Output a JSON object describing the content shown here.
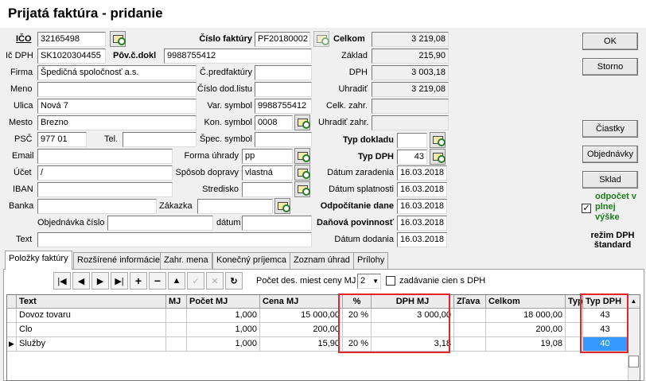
{
  "window": {
    "title": "Prijatá faktúra  -  pridanie"
  },
  "left": {
    "ico_label": "IČO",
    "ico_value": "32165498",
    "icdph_label": "Ič DPH",
    "icdph_value": "SK1020304455",
    "pov_label": "Pôv.č.dokl",
    "pov_value": "9988755412",
    "firma_label": "Firma",
    "firma_value": "Špedičná spoločnosť a.s.",
    "meno_label": "Meno",
    "meno_value": "",
    "ulica_label": "Ulica",
    "ulica_value": "Nová 7",
    "mesto_label": "Mesto",
    "mesto_value": "Brezno",
    "psc_label": "PSČ",
    "psc_value": "977 01",
    "tel_label": "Tel.",
    "tel_value": "",
    "email_label": "Email",
    "email_value": "",
    "ucet_label": "Účet",
    "ucet_value": "/",
    "iban_label": "IBAN",
    "iban_value": "",
    "banka_label": "Banka",
    "banka_value": "",
    "objednavka_label": "Objednávka číslo",
    "objednavka_value": "",
    "text_label": "Text",
    "text_value": ""
  },
  "middle": {
    "cislo_faktury_label": "Číslo faktúry",
    "cislo_faktury_value": "PF20180002",
    "cpredfaktury_label": "Č.predfaktúry",
    "cpredfaktury_value": "",
    "cdodlistu_label": "Číslo dod.listu",
    "cdodlistu_value": "",
    "var_symbol_label": "Var. symbol",
    "var_symbol_value": "9988755412",
    "kon_symbol_label": "Kon. symbol",
    "kon_symbol_value": "0008",
    "spec_symbol_label": "Špec. symbol",
    "spec_symbol_value": "",
    "forma_uhrady_label": "Forma úhrady",
    "forma_uhrady_value": "pp",
    "sposob_dopravy_label": "Spôsob dopravy",
    "sposob_dopravy_value": "vlastná",
    "stredisko_label": "Stredisko",
    "stredisko_value": "",
    "zakazka_label": "Zákazka",
    "zakazka_value": "",
    "datum_label": "dátum",
    "datum_value": ""
  },
  "totals": {
    "celkom_label": "Celkom",
    "celkom_value": "3 219,08",
    "zaklad_label": "Základ",
    "zaklad_value": "215,90",
    "dph_label": "DPH",
    "dph_value": "3 003,18",
    "uhradit_label": "Uhradiť",
    "uhradit_value": "3 219,08",
    "celk_zahr_label": "Celk. zahr.",
    "celk_zahr_value": "",
    "uhradit_zahr_label": "Uhradiť zahr.",
    "uhradit_zahr_value": "",
    "typ_dokladu_label": "Typ dokladu",
    "typ_dokladu_value": "",
    "typ_dph_label": "Typ DPH",
    "typ_dph_value": "43",
    "datum_zaradenia_label": "Dátum zaradenia",
    "datum_zaradenia_value": "16.03.2018",
    "datum_splatnosti_label": "Dátum splatnosti",
    "datum_splatnosti_value": "16.03.2018",
    "odpocitanie_label": "Odpočítanie dane",
    "odpocitanie_value": "16.03.2018",
    "danova_label": "Daňová povinnosť",
    "danova_value": "16.03.2018",
    "datum_dodania_label": "Dátum dodania",
    "datum_dodania_value": "16.03.2018"
  },
  "buttons": {
    "ok": "OK",
    "storno": "Storno",
    "ciastky": "Čiastky",
    "objednavky": "Objednávky",
    "sklad": "Sklad"
  },
  "odpocet": {
    "checked": true,
    "label": "odpočet v plnej výške",
    "rezim": "režim DPH štandard",
    "color": "#1a7f1a"
  },
  "tabs": [
    "Položky faktúry",
    "Rozšírené informácie",
    "Zahr. mena",
    "Konečný príjemca",
    "Zoznam úhrad",
    "Prílohy"
  ],
  "toolbar": {
    "pocet_label": "Počet des. miest ceny MJ",
    "pocet_value": "2",
    "zadavanie_label": "zadávanie cien s DPH"
  },
  "grid": {
    "columns": [
      "Text",
      "MJ",
      "Počet MJ",
      "Cena MJ",
      "%",
      "DPH MJ",
      "Zľava",
      "Celkom",
      "Typ",
      "Typ DPH"
    ],
    "rows": [
      {
        "text": "Dovoz tovaru",
        "mj": "",
        "pocet": "1,000",
        "cena": "15 000,00",
        "pct": "20 %",
        "dph": "3 000,00",
        "zlava": "",
        "celkom": "18 000,00",
        "typ": "",
        "typdph": "43"
      },
      {
        "text": "Clo",
        "mj": "",
        "pocet": "1,000",
        "cena": "200,00",
        "pct": "",
        "dph": "",
        "zlava": "",
        "celkom": "200,00",
        "typ": "",
        "typdph": "43"
      },
      {
        "text": "Služby",
        "mj": "",
        "pocet": "1,000",
        "cena": "15,90",
        "pct": "20 %",
        "dph": "3,18",
        "zlava": "",
        "celkom": "19,08",
        "typ": "",
        "typdph": "40"
      }
    ],
    "selected_color": "#3399ff",
    "highlight_color": "#e0252b"
  }
}
